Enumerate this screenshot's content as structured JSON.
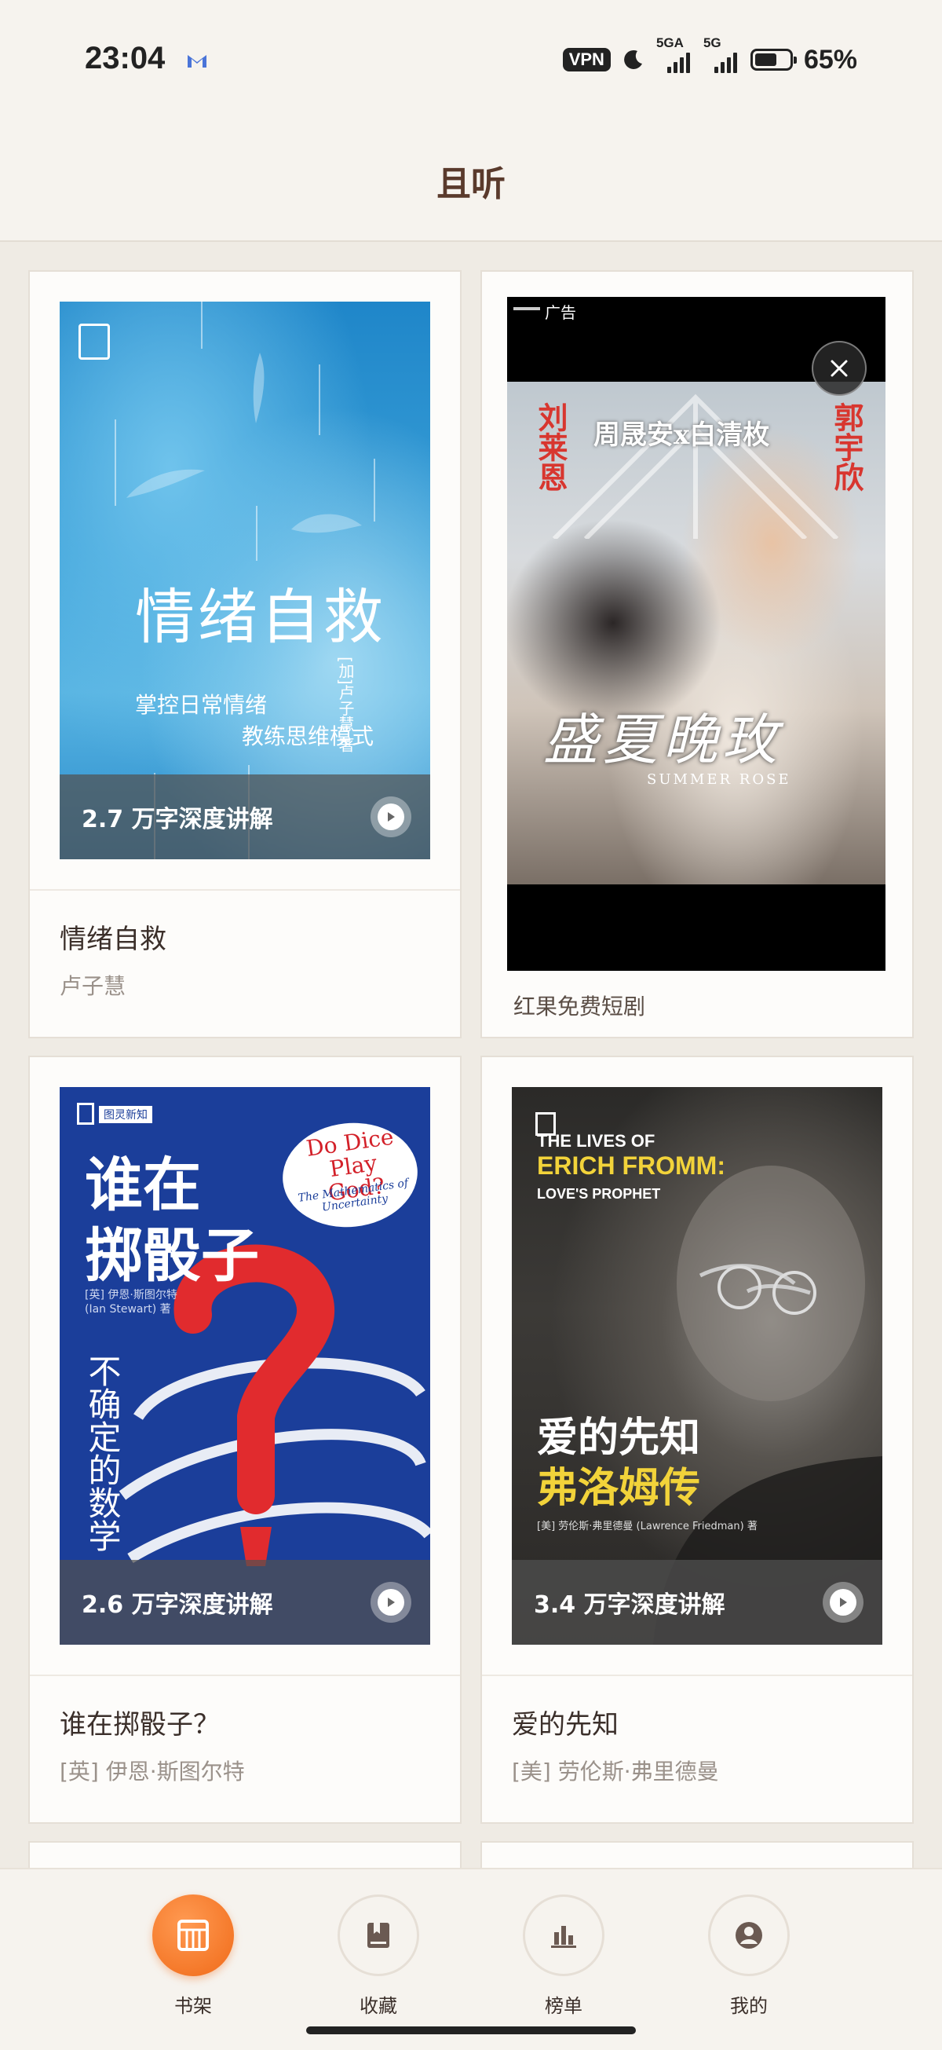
{
  "status_bar": {
    "time": "23:04",
    "vpn": "VPN",
    "net1_label": "5GA",
    "net2_label": "5G",
    "battery_percent": 65,
    "battery_text": "65%"
  },
  "header": {
    "title": "且听"
  },
  "books": [
    {
      "title": "情绪自救",
      "author": "卢子慧",
      "depth_label": "2.7 万字深度讲解",
      "cover": {
        "title": "情绪自救",
        "subtitle_line1": "掌控日常情绪",
        "subtitle_line2": "教练思维模式",
        "author": "[加]卢子慧 著"
      }
    },
    {
      "title": "谁在掷骰子？",
      "author": "[英] 伊恩·斯图尔特",
      "depth_label": "2.6 万字深度讲解",
      "cover": {
        "series": "图灵新知",
        "title_line1": "谁在",
        "title_line2": "掷骰子",
        "bubble_line1": "Do Dice",
        "bubble_line2": "Play God?",
        "bubble_sub": "The Mathematics of Uncertainty",
        "author": "[英] 伊恩·斯图尔特 (Ian Stewart) 著",
        "vertical": "不确定的数学"
      }
    },
    {
      "title": "爱的先知",
      "author": "[美] 劳伦斯·弗里德曼",
      "depth_label": "3.4 万字深度讲解",
      "cover": {
        "en_line1": "THE LIVES OF",
        "en_line2": "ERICH FROMM:",
        "en_line3": "LOVE'S PROPHET",
        "cn_line1": "爱的先知",
        "cn_line2": "弗洛姆传",
        "author": "[美] 劳伦斯·弗里德曼 (Lawrence Friedman) 著"
      }
    }
  ],
  "ad": {
    "label": "广告",
    "actor_left": "刘莱恩",
    "actor_right": "郭宇欣",
    "pair": "周晟安x白清枚",
    "script_title": "盛夏晚玫",
    "english_title": "SUMMER ROSE",
    "source": "红果免费短剧"
  },
  "bottom_nav": {
    "items": [
      {
        "label": "书架",
        "icon": "bookshelf-icon",
        "active": true
      },
      {
        "label": "收藏",
        "icon": "bookmark-book-icon",
        "active": false
      },
      {
        "label": "榜单",
        "icon": "ranking-chart-icon",
        "active": false
      },
      {
        "label": "我的",
        "icon": "user-profile-icon",
        "active": false
      }
    ]
  },
  "colors": {
    "accent": "#f27a24",
    "title_brown": "#5a3a2c",
    "background": "#efebe4"
  }
}
